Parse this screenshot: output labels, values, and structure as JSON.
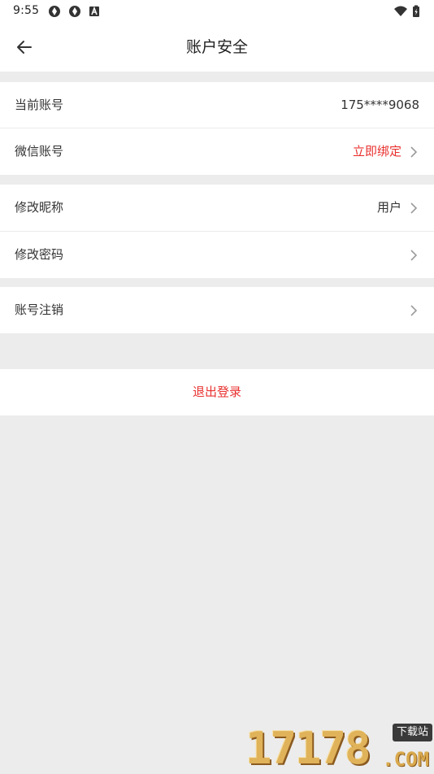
{
  "status_bar": {
    "time": "9:55",
    "icons": [
      "aperture-icon",
      "aperture-icon",
      "font-icon"
    ],
    "right_icons": [
      "wifi-icon",
      "battery-charging-icon"
    ]
  },
  "header": {
    "title": "账户安全",
    "back_icon": "arrow-left-icon"
  },
  "rows": [
    {
      "label": "当前账号",
      "value": "175****9068"
    },
    {
      "label": "微信账号",
      "value": "立即绑定"
    },
    {
      "label": "修改昵称",
      "value": "用户"
    },
    {
      "label": "修改密码",
      "value": ""
    },
    {
      "label": "账号注销",
      "value": ""
    }
  ],
  "logout": {
    "label": "退出登录"
  },
  "watermark": {
    "digits": "17178",
    "tag": "下载站",
    "suffix": ".COM"
  },
  "colors": {
    "background": "#ececec",
    "card": "#ffffff",
    "accent": "#e8312f",
    "text": "#333333"
  }
}
